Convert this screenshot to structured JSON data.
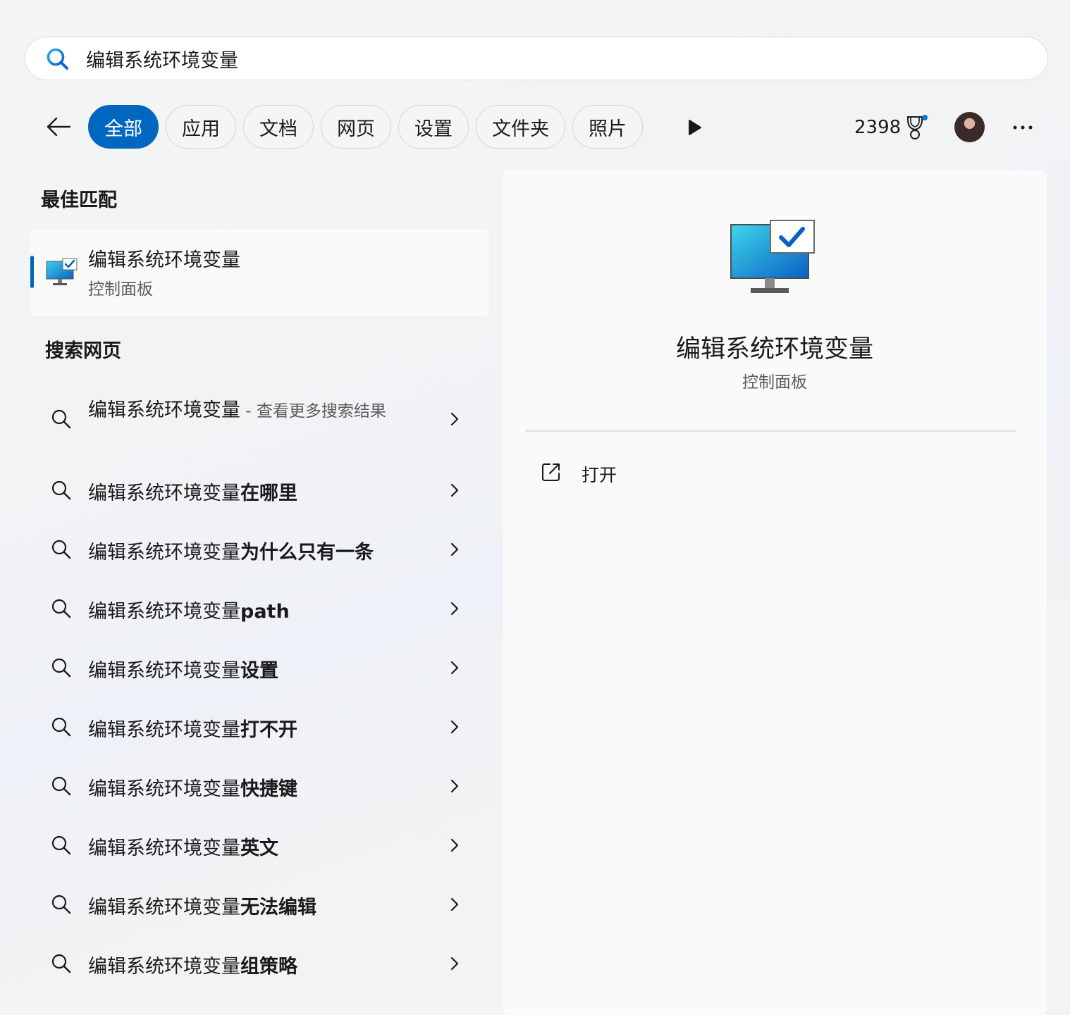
{
  "search": {
    "query": "编辑系统环境变量"
  },
  "tabs": [
    {
      "label": "全部",
      "active": true
    },
    {
      "label": "应用"
    },
    {
      "label": "文档"
    },
    {
      "label": "网页"
    },
    {
      "label": "设置"
    },
    {
      "label": "文件夹"
    },
    {
      "label": "照片"
    }
  ],
  "header": {
    "points": "2398"
  },
  "best_match": {
    "title": "最佳匹配",
    "name": "编辑系统环境变量",
    "sub": "控制面板"
  },
  "web": {
    "title": "搜索网页",
    "first": {
      "base": "编辑系统环境变量",
      "more": " - 查看更多搜索结果"
    },
    "items": [
      {
        "base": "编辑系统环境变量",
        "suffix": "在哪里"
      },
      {
        "base": "编辑系统环境变量",
        "suffix": "为什么只有一条"
      },
      {
        "base": "编辑系统环境变量",
        "suffix": "path"
      },
      {
        "base": "编辑系统环境变量",
        "suffix": "设置"
      },
      {
        "base": "编辑系统环境变量",
        "suffix": "打不开"
      },
      {
        "base": "编辑系统环境变量",
        "suffix": "快捷键"
      },
      {
        "base": "编辑系统环境变量",
        "suffix": "英文"
      },
      {
        "base": "编辑系统环境变量",
        "suffix": "无法编辑"
      },
      {
        "base": "编辑系统环境变量",
        "suffix": "组策略"
      }
    ]
  },
  "detail": {
    "title": "编辑系统环境变量",
    "sub": "控制面板",
    "actions": [
      {
        "label": "打开",
        "icon": "open-external-icon"
      }
    ]
  },
  "colors": {
    "accent": "#0067c0"
  }
}
